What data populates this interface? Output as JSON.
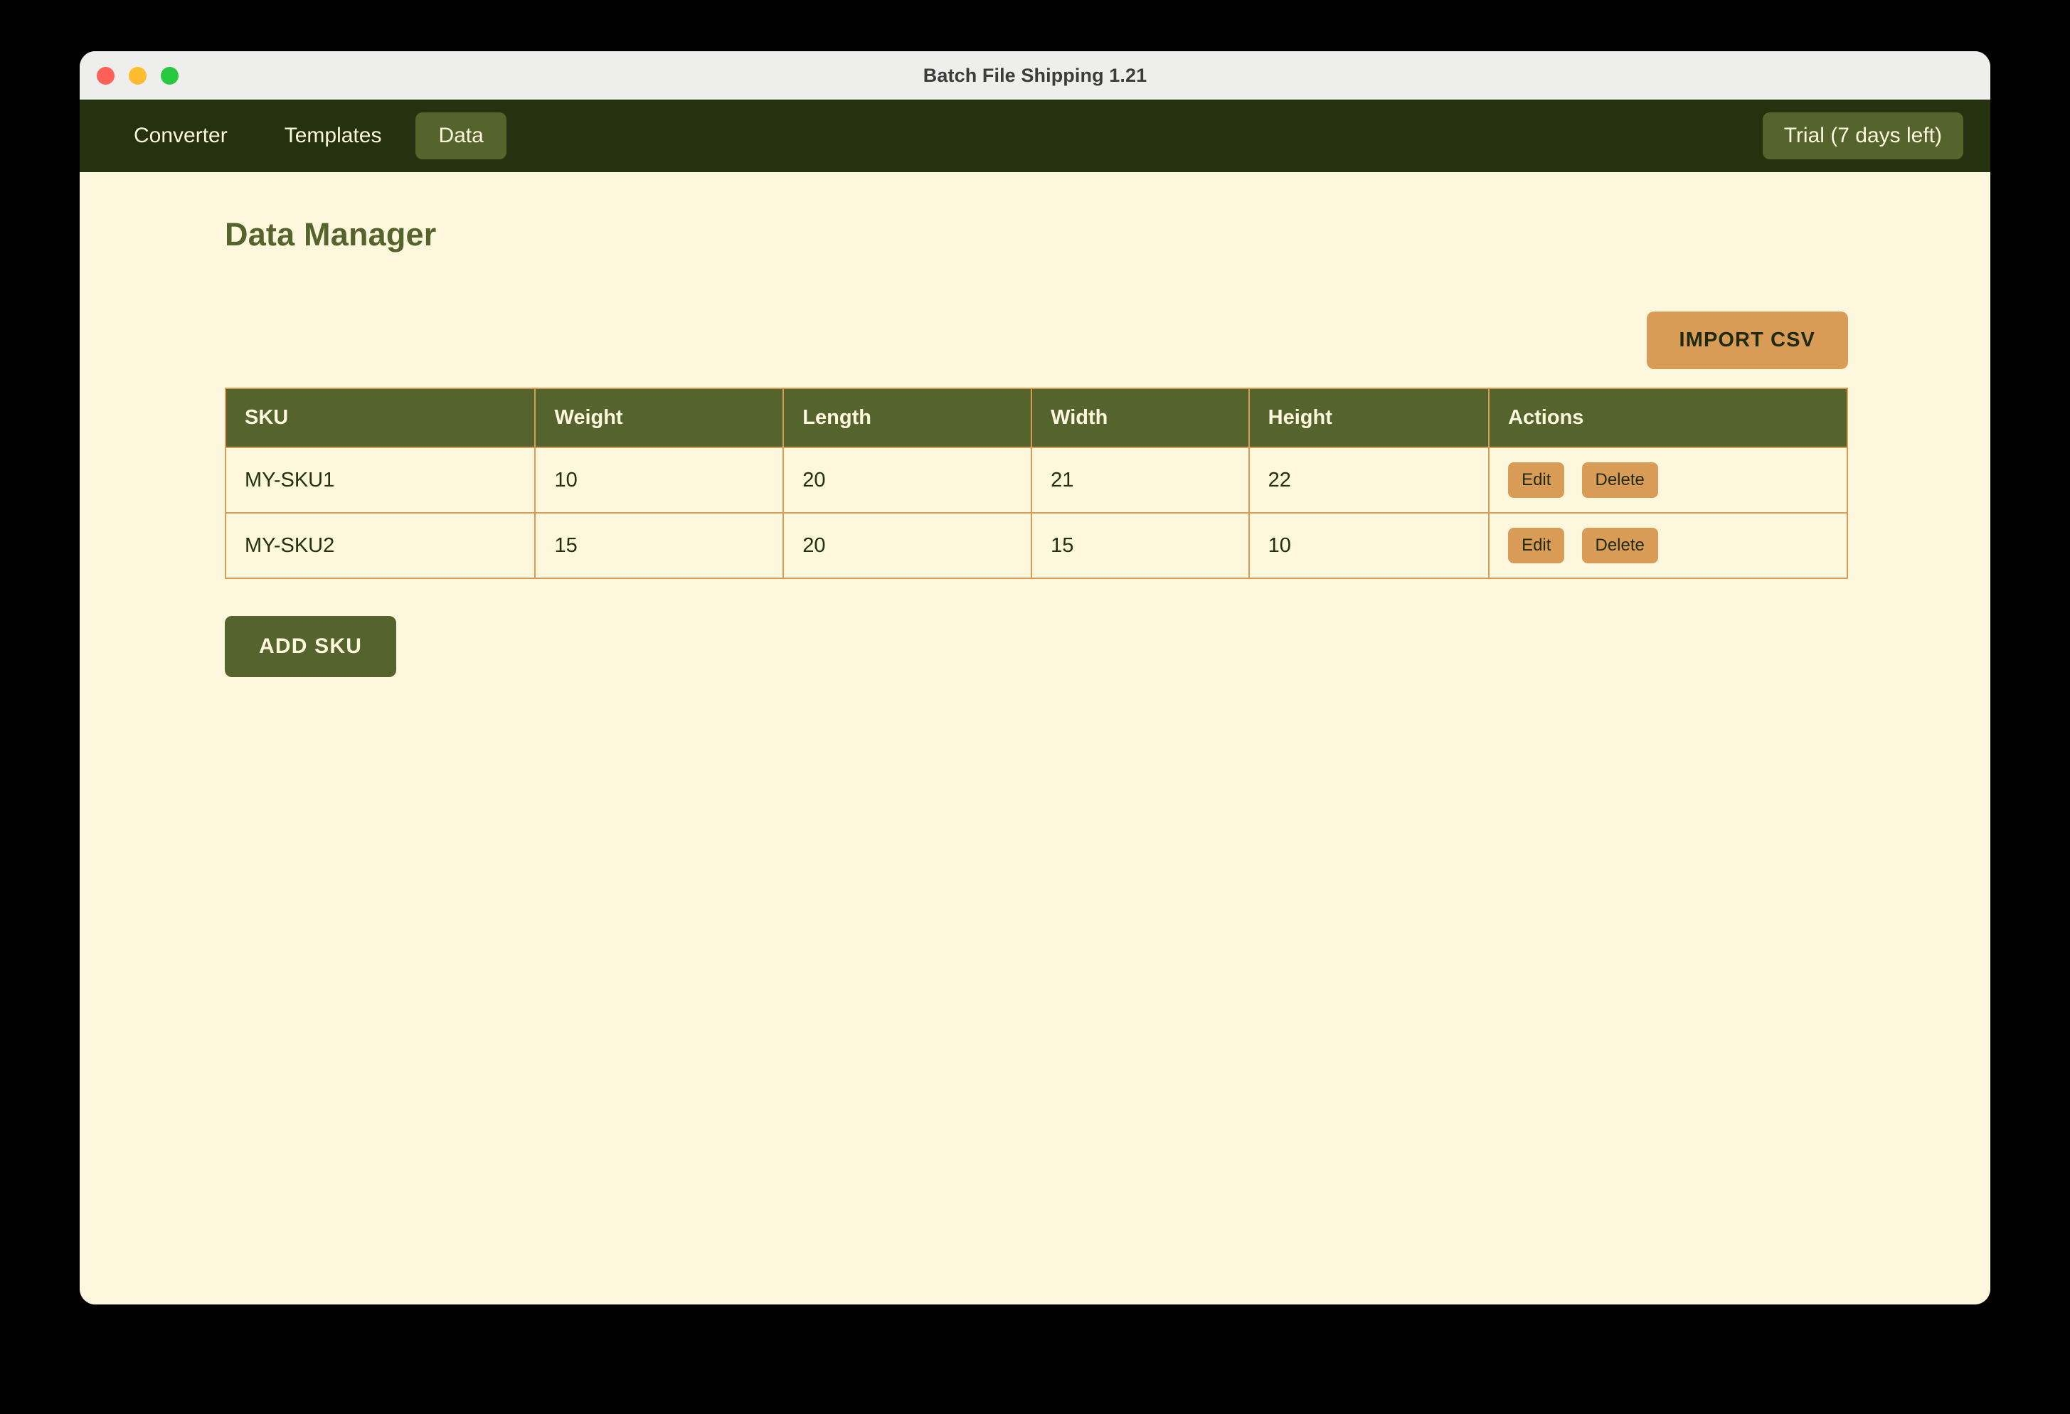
{
  "window": {
    "title": "Batch File Shipping 1.21",
    "traffic_lights": [
      "close",
      "minimize",
      "maximize"
    ]
  },
  "nav": {
    "tabs": [
      {
        "label": "Converter",
        "active": false
      },
      {
        "label": "Templates",
        "active": false
      },
      {
        "label": "Data",
        "active": true
      }
    ],
    "trial_badge": "Trial (7 days left)"
  },
  "page": {
    "title": "Data Manager",
    "import_button": "IMPORT CSV",
    "add_button": "ADD SKU"
  },
  "table": {
    "columns": [
      "SKU",
      "Weight",
      "Length",
      "Width",
      "Height",
      "Actions"
    ],
    "row_actions": {
      "edit": "Edit",
      "delete": "Delete"
    },
    "rows": [
      {
        "sku": "MY-SKU1",
        "weight": "10",
        "length": "20",
        "width": "21",
        "height": "22"
      },
      {
        "sku": "MY-SKU2",
        "weight": "15",
        "length": "20",
        "width": "15",
        "height": "10"
      }
    ]
  },
  "colors": {
    "nav_bg": "#26310f",
    "olive": "#55632d",
    "cream": "#fdf7dd",
    "tan": "#d99c57",
    "titlebar": "#eeeeec",
    "text_dark": "#22300d"
  }
}
